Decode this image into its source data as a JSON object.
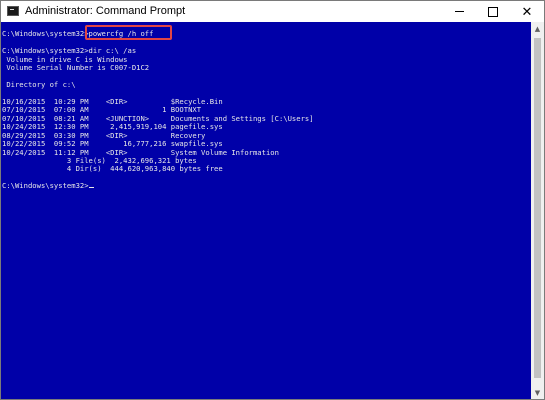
{
  "window": {
    "title": "Administrator: Command Prompt",
    "controls": {
      "minimize": "minimize",
      "maximize": "maximize",
      "close": "✕"
    }
  },
  "console": {
    "lines": [
      "",
      "C:\\Windows\\system32>powercfg /h off",
      "",
      "C:\\Windows\\system32>dir c:\\ /as",
      " Volume in drive C is Windows",
      " Volume Serial Number is C007-D1C2",
      "",
      " Directory of c:\\",
      "",
      "10/16/2015  10:29 PM    <DIR>          $Recycle.Bin",
      "07/10/2015  07:00 AM                 1 BOOTNXT",
      "07/10/2015  08:21 AM    <JUNCTION>     Documents and Settings [C:\\Users]",
      "10/24/2015  12:30 PM     2,415,919,104 pagefile.sys",
      "08/29/2015  03:30 PM    <DIR>          Recovery",
      "10/22/2015  09:52 PM        16,777,216 swapfile.sys",
      "10/24/2015  11:12 PM    <DIR>          System Volume Information",
      "               3 File(s)  2,432,696,321 bytes",
      "               4 Dir(s)  444,620,963,840 bytes free",
      "",
      "C:\\Windows\\system32>"
    ]
  },
  "highlight_label": "powercfg /h off",
  "colors": {
    "console_bg": "#0000a8",
    "console_text": "#e8e8e8",
    "highlight": "#e04545"
  }
}
